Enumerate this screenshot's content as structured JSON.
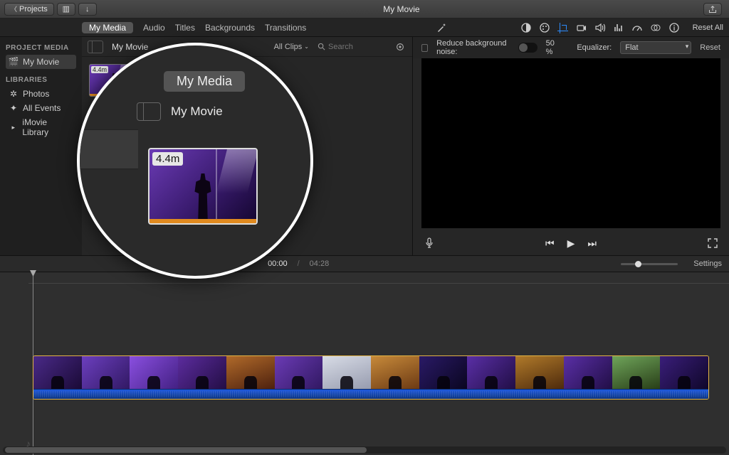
{
  "window": {
    "title": "My Movie"
  },
  "toolbar": {
    "back_label": "Projects"
  },
  "tabs": {
    "my_media": "My Media",
    "audio": "Audio",
    "titles": "Titles",
    "backgrounds": "Backgrounds",
    "transitions": "Transitions"
  },
  "inspector": {
    "reset_all": "Reset All",
    "reduce_noise": "Reduce background noise:",
    "noise_pct": "50 %",
    "equalizer_label": "Equalizer:",
    "equalizer_value": "Flat",
    "reset": "Reset"
  },
  "sidebar": {
    "project_media_head": "PROJECT MEDIA",
    "project_item": "My Movie",
    "libraries_head": "LIBRARIES",
    "photos": "Photos",
    "all_events": "All Events",
    "imovie_library": "iMovie Library"
  },
  "browser": {
    "title": "My Movie",
    "all_clips": "All Clips",
    "search_placeholder": "Search",
    "clip_duration": "4.4m"
  },
  "transport": {
    "current": "00:00",
    "duration": "04:28",
    "settings": "Settings"
  },
  "lens": {
    "tab": "My Media",
    "title": "My Movie",
    "duration": "4.4m"
  },
  "timeline_frames": [
    {
      "bg": "linear-gradient(135deg,#4a2a88,#14062c)"
    },
    {
      "bg": "linear-gradient(135deg,#6c3fbf,#2a1458)"
    },
    {
      "bg": "linear-gradient(135deg,#8a4fe0,#3b1b78)"
    },
    {
      "bg": "linear-gradient(135deg,#5c2c9e,#1c0a3a)"
    },
    {
      "bg": "linear-gradient(160deg,#b06a2a,#3a1208)"
    },
    {
      "bg": "linear-gradient(135deg,#6b3bb5,#2a1458)"
    },
    {
      "bg": "linear-gradient(160deg,#d8dce6,#8a8fa4)"
    },
    {
      "bg": "linear-gradient(160deg,#c78a3a,#5a2a0c)"
    },
    {
      "bg": "linear-gradient(135deg,#2a1a66,#060318)"
    },
    {
      "bg": "linear-gradient(135deg,#5a2fa6,#1a0a3a)"
    },
    {
      "bg": "linear-gradient(160deg,#b07a2a,#3a1a06)"
    },
    {
      "bg": "linear-gradient(135deg,#5a2fa6,#1a0a3a)"
    },
    {
      "bg": "linear-gradient(160deg,#6fa45a,#1a2a0a)"
    },
    {
      "bg": "linear-gradient(135deg,#3a1e7a,#0a0420)"
    }
  ]
}
